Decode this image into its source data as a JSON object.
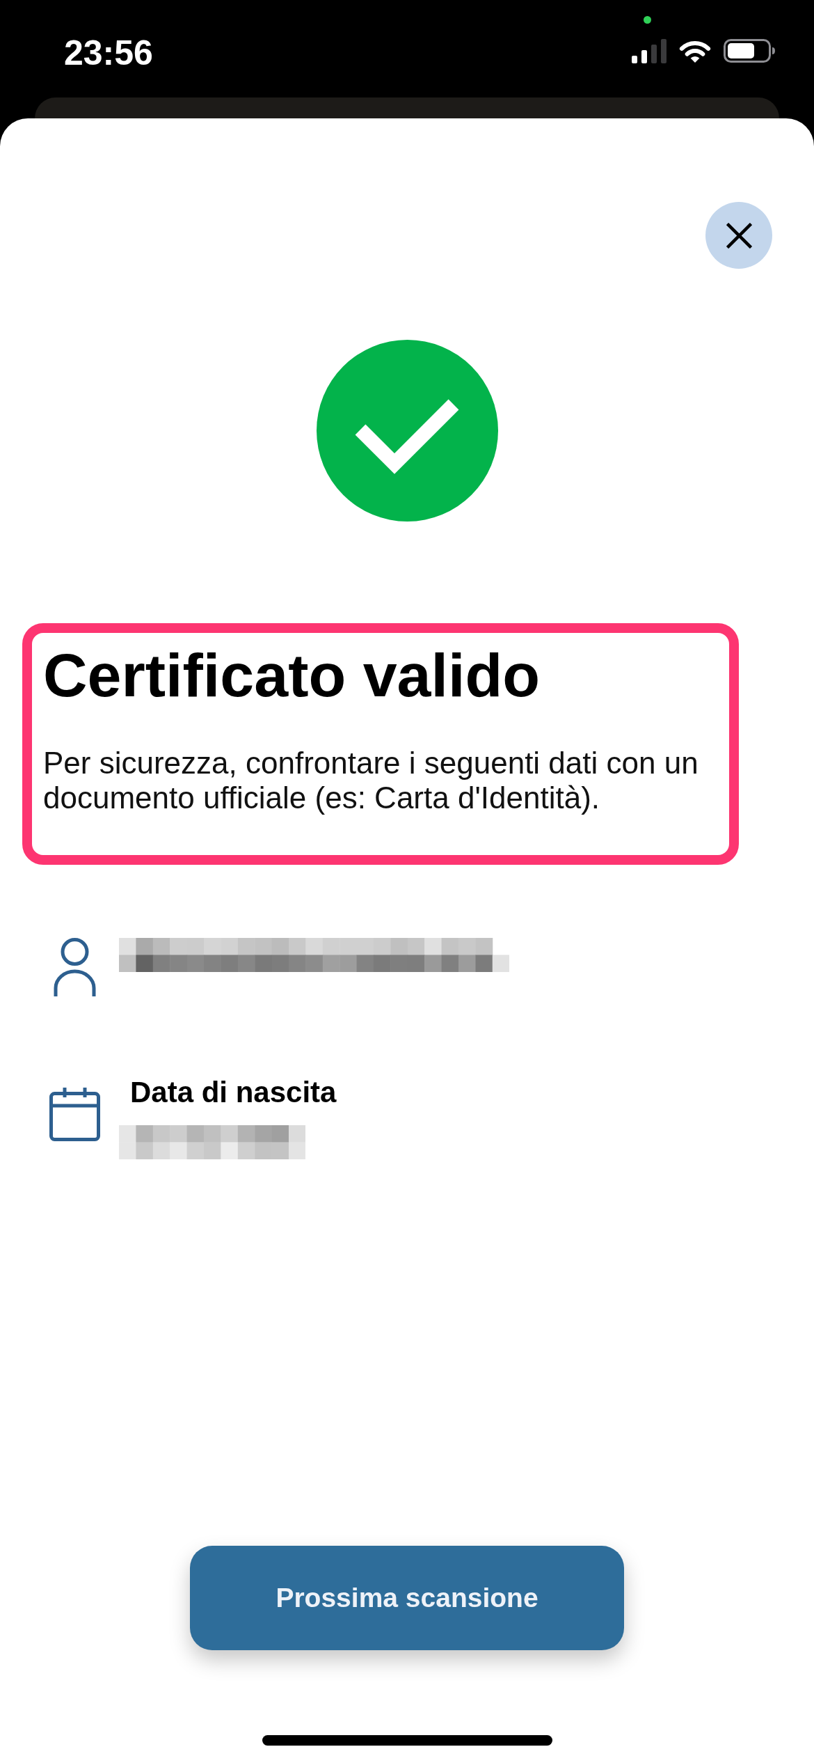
{
  "status_bar": {
    "time": "23:56"
  },
  "result": {
    "kind": "valid",
    "highlighted": true,
    "title": "Certificato valido",
    "message": "Per sicurezza, confrontare i seguenti dati con un documento ufficiale (es: Carta d'Identità)."
  },
  "fields": [
    {
      "kind": "person",
      "redacted": true
    },
    {
      "kind": "date",
      "label": "Data di nascita",
      "redacted": true
    }
  ],
  "primary_button": {
    "label": "Prossima scansione"
  }
}
